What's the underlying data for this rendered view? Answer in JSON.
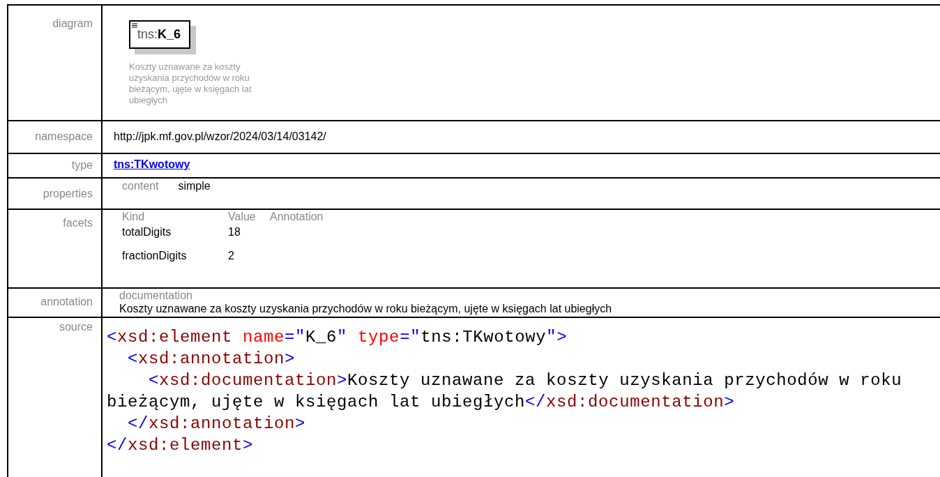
{
  "rows": [
    {
      "kind": "diagram",
      "label": "diagram",
      "element": {
        "prefix": "tns:",
        "name": "K_6"
      },
      "description": "Koszty uznawane za koszty uzyskania przychodów w roku bieżącym, ujęte w księgach lat ubiegłych"
    },
    {
      "kind": "text",
      "label": "namespace",
      "value": "http://jpk.mf.gov.pl/wzor/2024/03/14/03142/"
    },
    {
      "kind": "link",
      "label": "type",
      "value": "tns:TKwotowy"
    },
    {
      "kind": "properties",
      "label": "properties",
      "items": [
        {
          "name": "content",
          "value": "simple"
        }
      ]
    },
    {
      "kind": "facets",
      "label": "facets",
      "columns": [
        "Kind",
        "Value",
        "Annotation"
      ],
      "items": [
        {
          "kind": "totalDigits",
          "value": "18"
        },
        {
          "kind": "fractionDigits",
          "value": "2"
        }
      ]
    },
    {
      "kind": "annotation",
      "label": "annotation",
      "heading": "documentation",
      "text": "Koszty uznawane za koszty uzyskania przychodów w roku bieżącym, ujęte w księgach lat ubiegłych"
    },
    {
      "kind": "source",
      "label": "source",
      "lines": [
        [
          {
            "kind": "bracket",
            "text": "<"
          },
          {
            "kind": "tag",
            "text": "xsd:element"
          },
          {
            "kind": "attr",
            "text": " name"
          },
          {
            "kind": "bracket",
            "text": "=\""
          },
          {
            "kind": "text",
            "text": "K_6"
          },
          {
            "kind": "bracket",
            "text": "\""
          },
          {
            "kind": "attr",
            "text": " type"
          },
          {
            "kind": "bracket",
            "text": "=\""
          },
          {
            "kind": "text",
            "text": "tns:TKwotowy"
          },
          {
            "kind": "bracket",
            "text": "\">"
          }
        ],
        [
          {
            "kind": "bracket",
            "text": "  <"
          },
          {
            "kind": "tag",
            "text": "xsd:annotation"
          },
          {
            "kind": "bracket",
            "text": ">"
          }
        ],
        [
          {
            "kind": "bracket",
            "text": "    <"
          },
          {
            "kind": "tag",
            "text": "xsd:documentation"
          },
          {
            "kind": "bracket",
            "text": ">"
          },
          {
            "kind": "text",
            "text": "Koszty uznawane za koszty uzyskania przychodów w roku"
          }
        ],
        [
          {
            "kind": "text",
            "text": "bieżącym, ujęte w księgach lat ubiegłych"
          },
          {
            "kind": "bracket",
            "text": "</"
          },
          {
            "kind": "tag",
            "text": "xsd:documentation"
          },
          {
            "kind": "bracket",
            "text": ">"
          }
        ],
        [
          {
            "kind": "bracket",
            "text": "  </"
          },
          {
            "kind": "tag",
            "text": "xsd:annotation"
          },
          {
            "kind": "bracket",
            "text": ">"
          }
        ],
        [
          {
            "kind": "bracket",
            "text": "</"
          },
          {
            "kind": "tag",
            "text": "xsd:element"
          },
          {
            "kind": "bracket",
            "text": ">"
          }
        ]
      ]
    }
  ]
}
